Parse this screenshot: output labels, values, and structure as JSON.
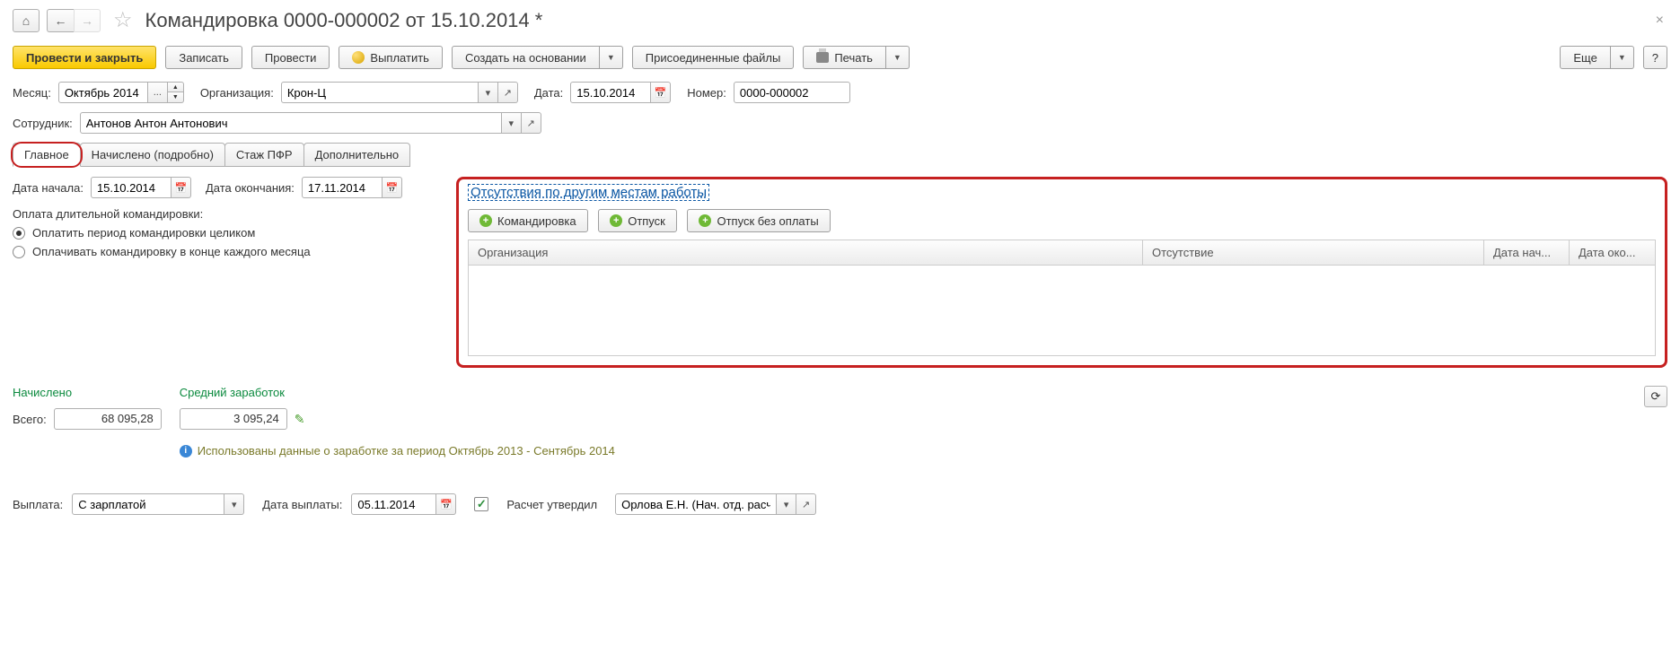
{
  "title": "Командировка 0000-000002 от 15.10.2014 *",
  "toolbar": {
    "post_close": "Провести и закрыть",
    "save": "Записать",
    "post": "Провести",
    "payout": "Выплатить",
    "create_based": "Создать на основании",
    "attachments": "Присоединенные файлы",
    "print": "Печать",
    "more": "Еще"
  },
  "fields": {
    "month_lbl": "Месяц:",
    "month_val": "Октябрь 2014",
    "org_lbl": "Организация:",
    "org_val": "Крон-Ц",
    "date_lbl": "Дата:",
    "date_val": "15.10.2014",
    "num_lbl": "Номер:",
    "num_val": "0000-000002",
    "employee_lbl": "Сотрудник:",
    "employee_val": "Антонов Антон Антонович"
  },
  "tabs": {
    "main": "Главное",
    "accrued": "Начислено (подробно)",
    "pfr": "Стаж ПФР",
    "extra": "Дополнительно"
  },
  "main_tab": {
    "start_lbl": "Дата начала:",
    "start_val": "15.10.2014",
    "end_lbl": "Дата окончания:",
    "end_val": "17.11.2014",
    "payment_lbl": "Оплата длительной командировки:",
    "radio1": "Оплатить период командировки целиком",
    "radio2": "Оплачивать командировку в конце каждого месяца"
  },
  "right_panel": {
    "title": "Отсутствия по другим местам работы",
    "btn_trip": "Командировка",
    "btn_vacation": "Отпуск",
    "btn_unpaid": "Отпуск без оплаты",
    "col_org": "Организация",
    "col_abs": "Отсутствие",
    "col_start": "Дата нач...",
    "col_end": "Дата око..."
  },
  "totals": {
    "accrued_lbl": "Начислено",
    "avg_lbl": "Средний заработок",
    "total_lbl": "Всего:",
    "total_val": "68 095,28",
    "avg_val": "3 095,24",
    "info": "Использованы данные о заработке за период Октябрь 2013 - Сентябрь 2014"
  },
  "bottom": {
    "payout_lbl": "Выплата:",
    "payout_val": "С зарплатой",
    "payout_date_lbl": "Дата выплаты:",
    "payout_date_val": "05.11.2014",
    "approved_lbl": "Расчет утвердил",
    "approved_val": "Орлова Е.Н. (Нач. отд. расче"
  }
}
